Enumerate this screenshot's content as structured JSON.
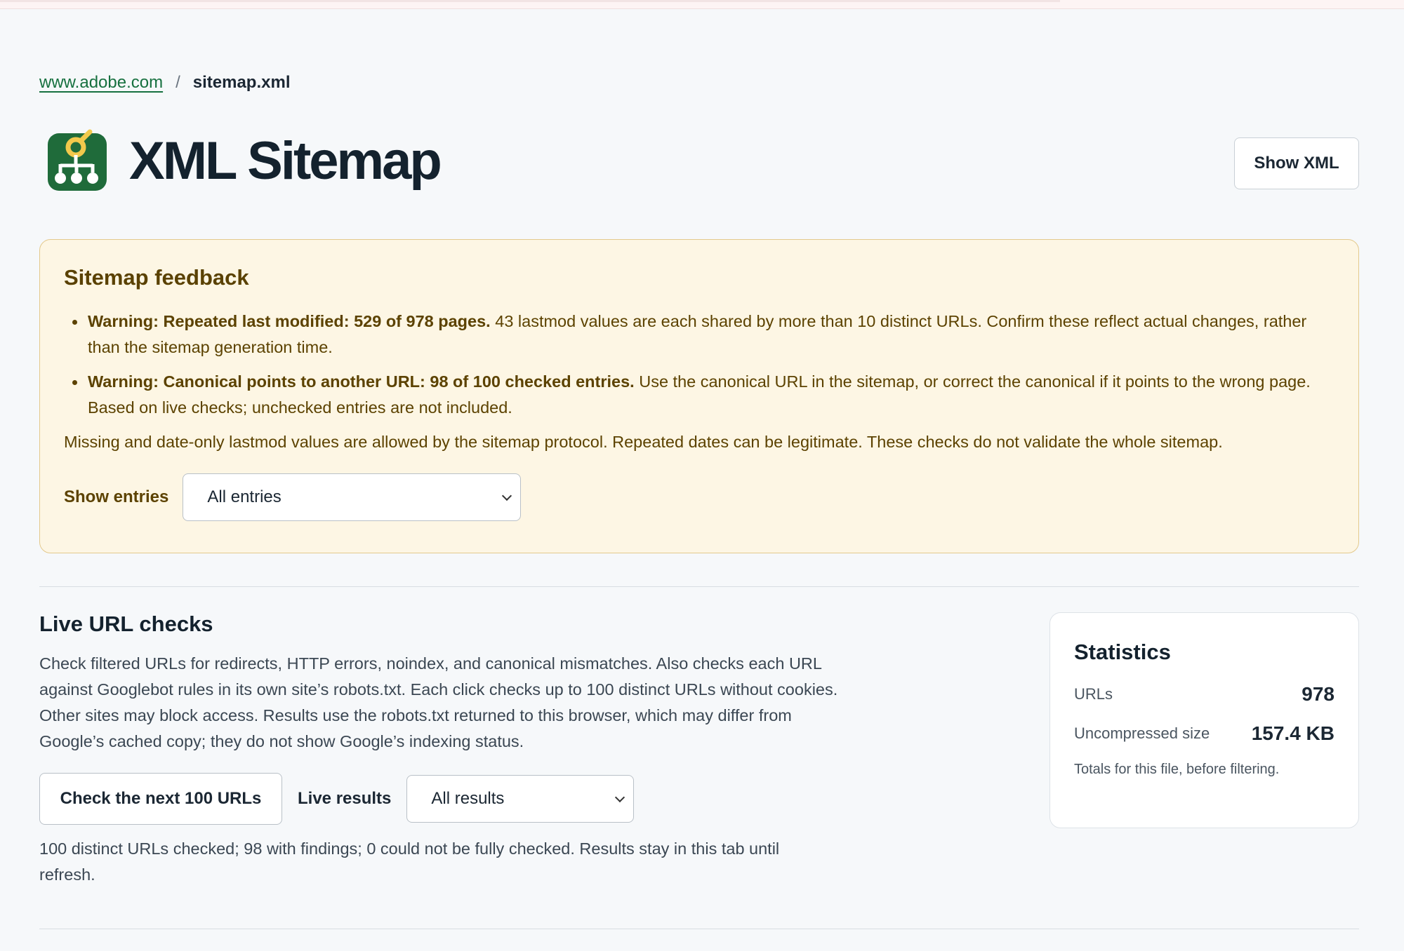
{
  "breadcrumb": {
    "site": "www.adobe.com",
    "separator": "/",
    "current": "sitemap.xml"
  },
  "header": {
    "title": "XML Sitemap",
    "logo_icon": "sitemap-logo-icon",
    "show_xml_label": "Show XML"
  },
  "feedback": {
    "title": "Sitemap feedback",
    "warnings": [
      {
        "strong": "Warning: Repeated last modified: 529 of 978 pages.",
        "text": " 43 lastmod values are each shared by more than 10 distinct URLs. Confirm these reflect actual changes, rather than the sitemap generation time."
      },
      {
        "strong": "Warning: Canonical points to another URL: 98 of 100 checked entries.",
        "text": " Use the canonical URL in the sitemap, or correct the canonical if it points to the wrong page. Based on live checks; unchecked entries are not included."
      }
    ],
    "note": "Missing and date-only lastmod values are allowed by the sitemap protocol. Repeated dates can be legitimate. These checks do not validate the whole sitemap.",
    "show_entries_label": "Show entries",
    "show_entries_value": "All entries"
  },
  "live": {
    "title": "Live URL checks",
    "description": "Check filtered URLs for redirects, HTTP errors, noindex, and canonical mismatches. Also checks each URL against Googlebot rules in its own site’s robots.txt. Each click checks up to 100 distinct URLs without cookies. Other sites may block access. Results use the robots.txt returned to this browser, which may differ from Google’s cached copy; they do not show Google’s indexing status.",
    "check_button": "Check the next 100 URLs",
    "results_label": "Live results",
    "results_value": "All results",
    "status": "100 distinct URLs checked; 98 with findings; 0 could not be fully checked. Results stay in this tab until refresh."
  },
  "stats": {
    "title": "Statistics",
    "rows": [
      {
        "key": "URLs",
        "value": "978"
      },
      {
        "key": "Uncompressed size",
        "value": "157.4 KB"
      }
    ],
    "footer": "Totals for this file, before filtering."
  },
  "colors": {
    "brand_green": "#1f6b3a",
    "brand_yellow": "#f2c94c",
    "warning_bg": "#fdf6e4",
    "warning_text": "#5c4200",
    "link": "#16703f"
  }
}
